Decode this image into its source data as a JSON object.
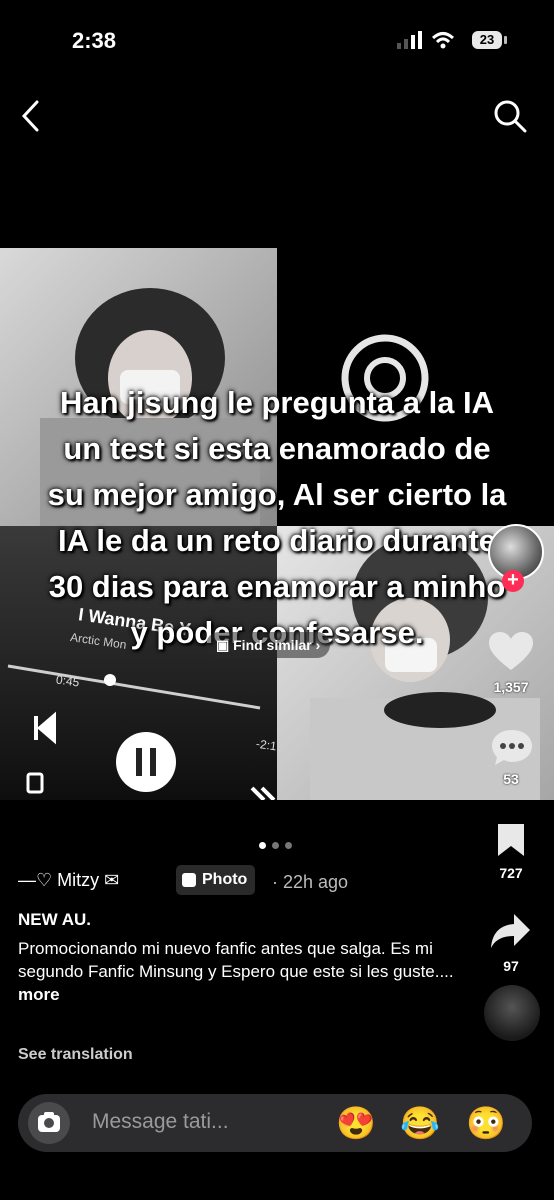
{
  "status": {
    "time": "2:38",
    "battery": "23"
  },
  "nav": {
    "back_icon": "chevron-left-icon",
    "search_icon": "search-icon"
  },
  "post": {
    "overlay_lines": [
      "Han jisung le pregunta a la IA",
      "un test si esta enamorado de",
      "su mejor amigo, Al ser cierto la",
      "IA le da un reto diario durante",
      "30 dias para enamorar a minho",
      "y poder confesarse."
    ],
    "find_similar": "Find similar",
    "music_card": {
      "song": "I Wanna Be Y",
      "artist": "Arctic Mon",
      "elapsed": "0:45",
      "remaining": "-2:1"
    },
    "carousel": {
      "count": 3,
      "active": 0
    }
  },
  "rail": {
    "likes": "1,357",
    "comments": "53",
    "saves": "727",
    "shares": "97"
  },
  "author": {
    "name": "—♡ Mitzy",
    "badge": "Photo",
    "ago": "· 22h ago"
  },
  "caption": {
    "title": "NEW AU.",
    "text": "Promocionando mi nuevo fanfic antes que salga. Es mi segundo Fanfic Minsung y Espero que este si les guste....",
    "more": "more",
    "see_translation": "See translation"
  },
  "message_bar": {
    "placeholder": "Message tati...",
    "emojis": [
      "😍",
      "😂",
      "😳"
    ]
  },
  "colors": {
    "background": "#000000",
    "like_plus": "#ff2c55",
    "input_bg": "#2c2c2e"
  }
}
